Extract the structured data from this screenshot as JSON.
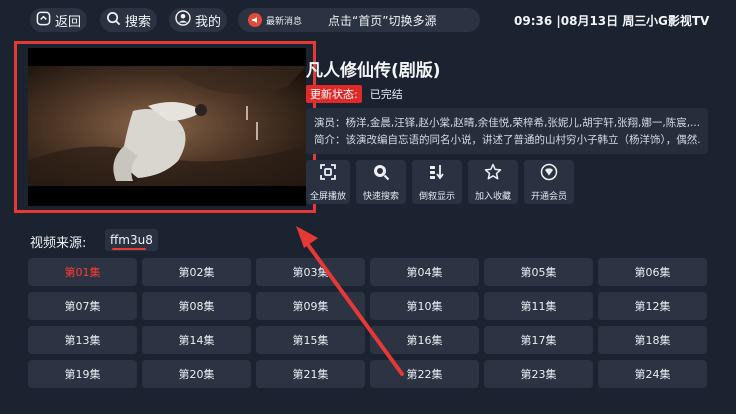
{
  "topbar": {
    "back_label": "返回",
    "search_label": "搜索",
    "mine_label": "我的",
    "notice_tag": "最新消息",
    "notice_text": "点击“首页”切换多源",
    "clock": "09:36 |08月13日 周三",
    "app_name": "小G影视TV"
  },
  "detail": {
    "title": "凡人修仙传(剧版)",
    "state_label": "更新状态:",
    "state_value": "已完结",
    "cast_line": "演员：杨洋,金晨,汪铎,赵小棠,赵晴,余佳悦,荣梓希,张妮儿,胡宇轩,张翔,娜一,陈宸,...",
    "intro_line": "简介：该演改编自忘语的同名小说，讲述了普通的山村穷小子韩立（杨洋饰），偶然..."
  },
  "actions": [
    {
      "label": "全屏播放",
      "icon": "fullscreen-icon"
    },
    {
      "label": "快速搜索",
      "icon": "search-icon"
    },
    {
      "label": "倒叙显示",
      "icon": "sort-icon"
    },
    {
      "label": "加入收藏",
      "icon": "star-icon"
    },
    {
      "label": "开通会员",
      "icon": "vip-icon"
    }
  ],
  "source": {
    "label": "视频来源:",
    "name": "ffm3u8"
  },
  "episodes": [
    "第01集",
    "第02集",
    "第03集",
    "第04集",
    "第05集",
    "第06集",
    "第07集",
    "第08集",
    "第09集",
    "第10集",
    "第11集",
    "第12集",
    "第13集",
    "第14集",
    "第15集",
    "第16集",
    "第17集",
    "第18集",
    "第19集",
    "第20集",
    "第21集",
    "第22集",
    "第23集",
    "第24集"
  ],
  "active_episode_index": 0,
  "colors": {
    "accent_red": "#e53935",
    "background": "#1b2230",
    "tile": "#2c3443"
  }
}
